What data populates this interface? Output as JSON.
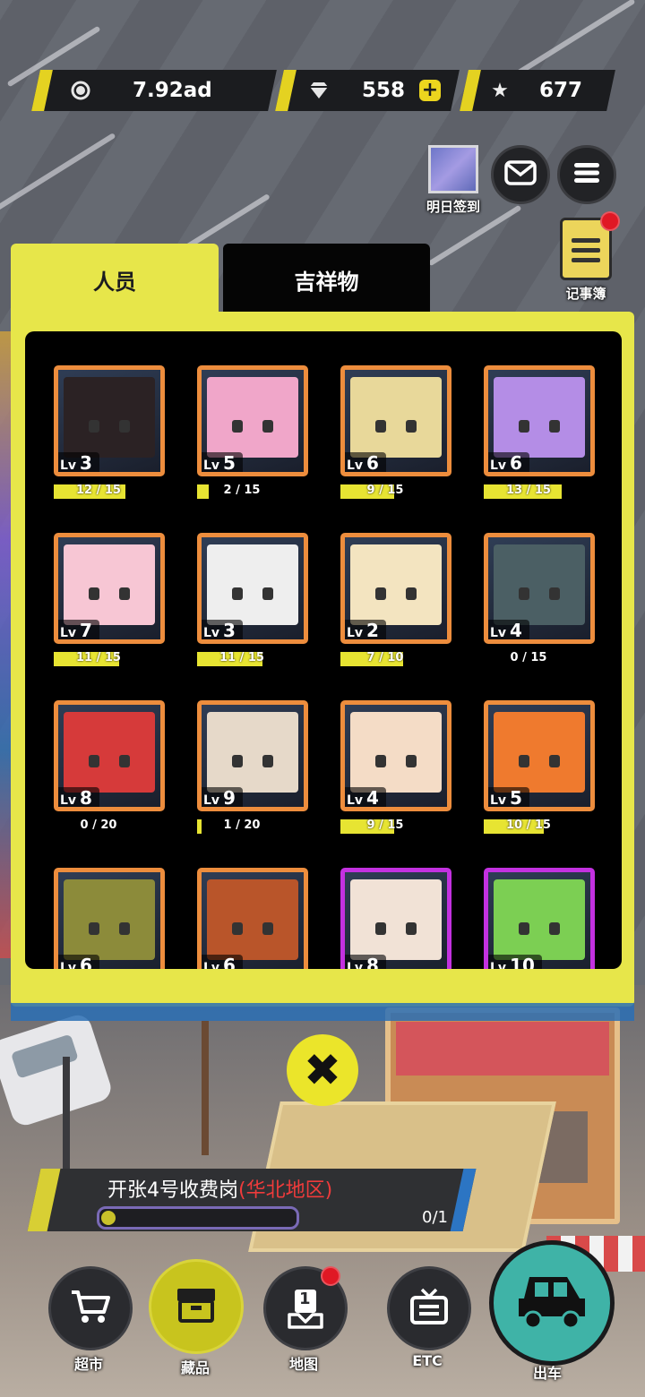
{
  "resources": {
    "coins": "7.92ad",
    "diamonds": "558",
    "stars": "677"
  },
  "topButtons": {
    "signin_label": "明日签到",
    "notebook_label": "记事簿"
  },
  "tabs": {
    "staff": "人员",
    "mascot": "吉祥物"
  },
  "characters": [
    {
      "level": "3",
      "progress": "12 / 15",
      "fill": 0.8,
      "color": "#2b2224"
    },
    {
      "level": "5",
      "progress": "2 / 15",
      "fill": 0.13,
      "color": "#f0a6c9"
    },
    {
      "level": "6",
      "progress": "9 / 15",
      "fill": 0.6,
      "color": "#e8d89a"
    },
    {
      "level": "6",
      "progress": "13 / 15",
      "fill": 0.87,
      "color": "#b48de6"
    },
    {
      "level": "7",
      "progress": "11 / 15",
      "fill": 0.73,
      "color": "#f7c6d4"
    },
    {
      "level": "3",
      "progress": "11 / 15",
      "fill": 0.73,
      "color": "#eeeeee"
    },
    {
      "level": "2",
      "progress": "7 / 10",
      "fill": 0.7,
      "color": "#f3e4c0"
    },
    {
      "level": "4",
      "progress": "0 / 15",
      "fill": 0,
      "color": "#4b5f64"
    },
    {
      "level": "8",
      "progress": "0 / 20",
      "fill": 0,
      "color": "#d63a3a"
    },
    {
      "level": "9",
      "progress": "1 / 20",
      "fill": 0.05,
      "color": "#e6d9c9"
    },
    {
      "level": "4",
      "progress": "9 / 15",
      "fill": 0.6,
      "color": "#f4dcc6"
    },
    {
      "level": "5",
      "progress": "10 / 15",
      "fill": 0.67,
      "color": "#ef7a2e"
    },
    {
      "level": "6",
      "progress": "",
      "fill": 0,
      "color": "#8c8b3a"
    },
    {
      "level": "6",
      "progress": "",
      "fill": 0,
      "color": "#b9552a"
    },
    {
      "level": "8",
      "progress": "",
      "fill": 0,
      "color": "#f1e2d6"
    },
    {
      "level": "10",
      "progress": "",
      "fill": 0,
      "color": "#7ccf53"
    }
  ],
  "lv_prefix": "Lv",
  "quest": {
    "title": "开张4号收费岗",
    "region": "(华北地区)",
    "count": "0/1",
    "progress": 0
  },
  "nav": {
    "market": "超市",
    "collection": "藏品",
    "map": "地图",
    "map_badge_num": "1",
    "etc": "ETC",
    "depart": "出车"
  },
  "colors": {
    "accent_yellow": "#e7e64a",
    "card_orange": "#ed8d3d",
    "card_purple": "#c331e0",
    "badge_red": "#e01824",
    "depart_teal": "#3fb3a7"
  }
}
